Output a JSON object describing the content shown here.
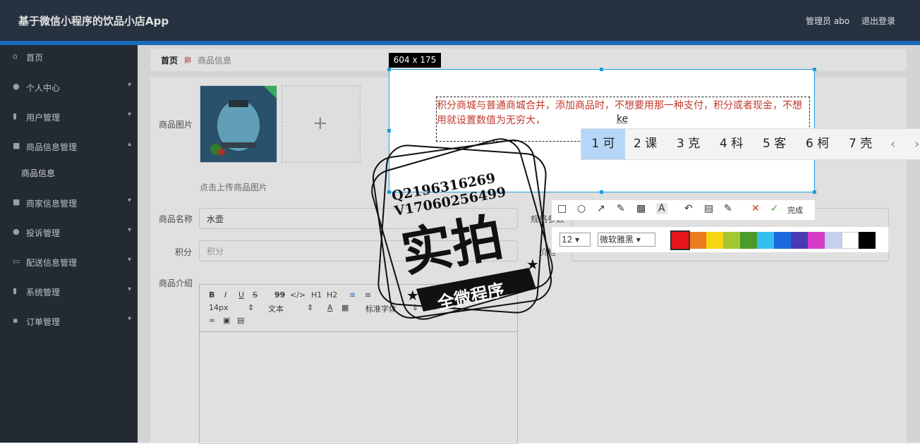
{
  "app": {
    "title": "基于微信小程序的饮品小店App",
    "user": "管理员 abo",
    "logout": "退出登录"
  },
  "sidebar": {
    "items": [
      {
        "label": "首页",
        "icon": "home-icon"
      },
      {
        "label": "个人中心",
        "icon": "user-icon"
      },
      {
        "label": "用户管理",
        "icon": "chart-icon"
      },
      {
        "label": "商品信息管理",
        "icon": "briefcase-icon"
      },
      {
        "label": "商家信息管理",
        "icon": "briefcase-icon"
      },
      {
        "label": "投诉管理",
        "icon": "user-icon"
      },
      {
        "label": "配送信息管理",
        "icon": "card-icon"
      },
      {
        "label": "系统管理",
        "icon": "bar-chart-icon"
      },
      {
        "label": "订单管理",
        "icon": "book-icon"
      }
    ],
    "sub_item": "商品信息"
  },
  "breadcrumb": {
    "home": "首页",
    "separator": "卵",
    "current": "商品信息"
  },
  "form": {
    "image_label": "商品图片",
    "upload_hint": "点击上传商品图片",
    "name_label": "商品名称",
    "name_value": "水壶",
    "points_label": "积分",
    "points_placeholder": "积分",
    "intro_label": "商品介绍",
    "spec_label": "规格参数",
    "price_label": "价格"
  },
  "editor": {
    "font_size": "14px",
    "font_type": "文本",
    "font_family": "标准字体",
    "buttons": [
      "B",
      "I",
      "U",
      "S",
      "99",
      "</>",
      "H1",
      "H2"
    ]
  },
  "screenshot_tool": {
    "size": "604 x 175",
    "text": "积分商城与普通商城合并，添加商品时，不想要用那一种支付，积分或者现金，不想用就设置数值为无穷大，",
    "composing": "ke",
    "candidates": [
      "1 可",
      "2 课",
      "3 克",
      "4 科",
      "5 客",
      "6 柯",
      "7 壳"
    ],
    "done_label": "完成",
    "font_size": "12",
    "font_name": "微软雅黑",
    "colors": [
      "#e8141c",
      "#ec7c1c",
      "#f5d514",
      "#a5c832",
      "#4a9a2c",
      "#35bff0",
      "#1c6ae0",
      "#4a3ab4",
      "#d43cc8",
      "#c5cfee",
      "#ffffff",
      "#000000"
    ]
  },
  "watermark": {
    "line1": "Q2196316269",
    "line2": "V17060256499",
    "big": "实拍",
    "banner": "全微程序"
  }
}
